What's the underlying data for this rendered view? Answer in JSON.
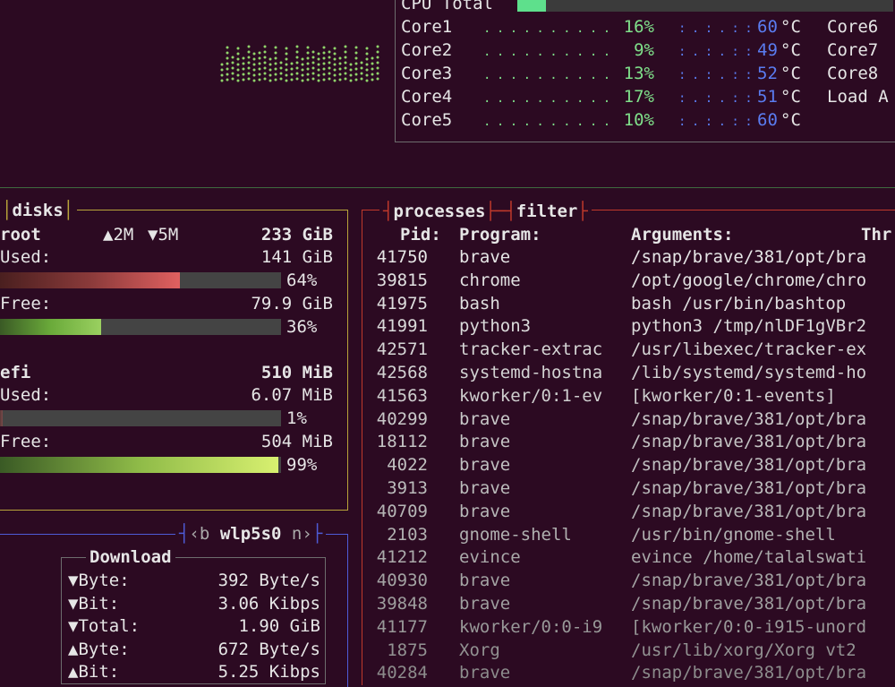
{
  "cpu": {
    "total_label": "CPU Total",
    "total_percent": 18,
    "cores": [
      {
        "name": "Core1",
        "percent": "16%",
        "temp": "60",
        "temp_unit": "°C",
        "side": "Core6"
      },
      {
        "name": "Core2",
        "percent": "9%",
        "temp": "49",
        "temp_unit": "°C",
        "side": "Core7"
      },
      {
        "name": "Core3",
        "percent": "13%",
        "temp": "52",
        "temp_unit": "°C",
        "side": "Core8"
      },
      {
        "name": "Core4",
        "percent": "17%",
        "temp": "51",
        "temp_unit": "°C",
        "side": "Load A"
      },
      {
        "name": "Core5",
        "percent": "10%",
        "temp": "60",
        "temp_unit": "°C",
        "side": ""
      }
    ]
  },
  "disks": {
    "title": "disks",
    "io_up": "2M",
    "io_down": "5M",
    "root": {
      "name": "root",
      "size": "233 GiB",
      "used_label": "Used:",
      "used_value": "141 GiB",
      "used_pct": "64%",
      "used_fill": 0.64,
      "free_label": "Free:",
      "free_value": "79.9 GiB",
      "free_pct": "36%",
      "free_fill": 0.36
    },
    "efi": {
      "name": "efi",
      "size": "510 MiB",
      "used_label": "Used:",
      "used_value": "6.07 MiB",
      "used_pct": "1%",
      "used_fill": 0.01,
      "free_label": "Free:",
      "free_value": "504 MiB",
      "free_pct": "99%",
      "free_fill": 0.99
    }
  },
  "net": {
    "prev_key": "b",
    "interface": "wlp5s0",
    "next_key": "n",
    "download_title": "Download",
    "rows": [
      {
        "arrow": "▼",
        "label": "Byte:",
        "value": "392 Byte/s"
      },
      {
        "arrow": "▼",
        "label": "Bit:",
        "value": "3.06 Kibps"
      },
      {
        "arrow": "▼",
        "label": "Total:",
        "value": "1.90 GiB"
      },
      {
        "arrow": "▲",
        "label": "Byte:",
        "value": "672 Byte/s"
      },
      {
        "arrow": "▲",
        "label": "Bit:",
        "value": "5.25 Kibps"
      }
    ]
  },
  "processes": {
    "title": "processes",
    "filter_label": "filter",
    "headers": {
      "pid": "Pid:",
      "program": "Program:",
      "arguments": "Arguments:",
      "threads": "Thr"
    },
    "rows": [
      {
        "pid": "41750",
        "program": "brave",
        "args": "/snap/brave/381/opt/bra"
      },
      {
        "pid": "39815",
        "program": "chrome",
        "args": "/opt/google/chrome/chro"
      },
      {
        "pid": "41975",
        "program": "bash",
        "args": "bash /usr/bin/bashtop"
      },
      {
        "pid": "41991",
        "program": "python3",
        "args": "python3 /tmp/nlDF1gVBr2"
      },
      {
        "pid": "42571",
        "program": "tracker-extrac",
        "args": "/usr/libexec/tracker-ex"
      },
      {
        "pid": "42568",
        "program": "systemd-hostna",
        "args": "/lib/systemd/systemd-ho"
      },
      {
        "pid": "41563",
        "program": "kworker/0:1-ev",
        "args": "[kworker/0:1-events]"
      },
      {
        "pid": "40299",
        "program": "brave",
        "args": "/snap/brave/381/opt/bra"
      },
      {
        "pid": "18112",
        "program": "brave",
        "args": "/snap/brave/381/opt/bra"
      },
      {
        "pid": "4022",
        "program": "brave",
        "args": "/snap/brave/381/opt/bra"
      },
      {
        "pid": "3913",
        "program": "brave",
        "args": "/snap/brave/381/opt/bra"
      },
      {
        "pid": "40709",
        "program": "brave",
        "args": "/snap/brave/381/opt/bra"
      },
      {
        "pid": "2103",
        "program": "gnome-shell",
        "args": "/usr/bin/gnome-shell"
      },
      {
        "pid": "41212",
        "program": "evince",
        "args": "evince /home/talalswati"
      },
      {
        "pid": "40930",
        "program": "brave",
        "args": "/snap/brave/381/opt/bra"
      },
      {
        "pid": "39848",
        "program": "brave",
        "args": "/snap/brave/381/opt/bra"
      },
      {
        "pid": "41177",
        "program": "kworker/0:0-i9",
        "args": "[kworker/0:0-i915-unord"
      },
      {
        "pid": "1875",
        "program": "Xorg",
        "args": "/usr/lib/xorg/Xorg vt2"
      },
      {
        "pid": "40284",
        "program": "brave",
        "args": "/snap/brave/381/opt/bra"
      }
    ]
  },
  "colors": {
    "background": "#2c0a22",
    "cpu_green": "#7fe08a",
    "temp_blue": "#5a7cf0",
    "disk_border": "#b8a43a",
    "proc_border": "#c0392b",
    "net_border": "#4e5bd6"
  }
}
